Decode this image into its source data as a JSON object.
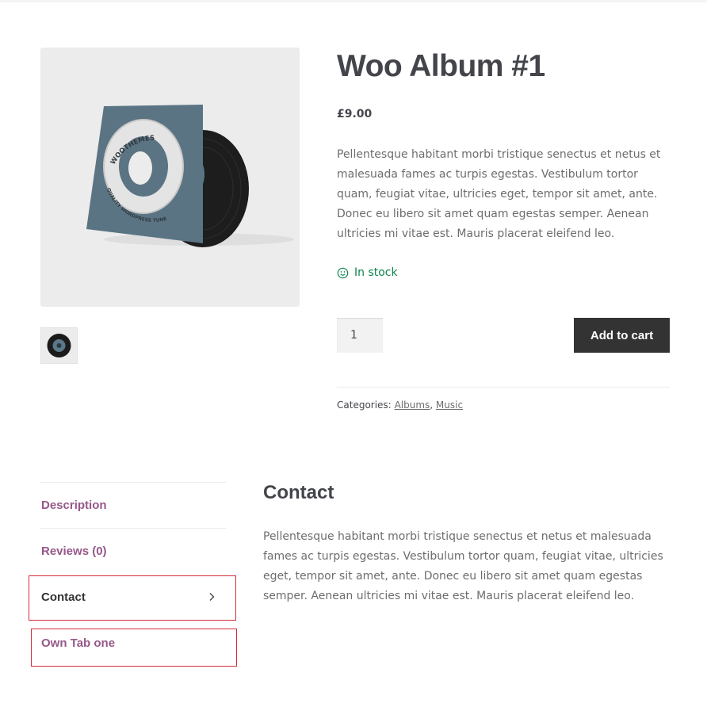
{
  "product": {
    "title": "Woo Album #1",
    "price": "£9.00",
    "description": "Pellentesque habitant morbi tristique senectus et netus et malesuada fames ac turpis egestas. Vestibulum tortor quam, feugiat vitae, ultricies eget, tempor sit amet, ante. Donec eu libero sit amet quam egestas semper. Aenean ultricies mi vitae est. Mauris placerat eleifend leo.",
    "stock": "In stock",
    "quantity": "1",
    "add_to_cart": "Add to cart",
    "categories_label": "Categories:",
    "categories": [
      "Albums",
      "Music"
    ],
    "image": {
      "cover_top_text": "WOOTHEMES",
      "cover_bottom_text": "QUALITY WORDPRESS TUNES"
    }
  },
  "tabs": {
    "items": [
      {
        "label": "Description"
      },
      {
        "label": "Reviews (0)"
      },
      {
        "label": "Contact"
      },
      {
        "label": "Own Tab one"
      }
    ],
    "active": "Contact"
  },
  "panel": {
    "title": "Contact",
    "text": "Pellentesque habitant morbi tristique senectus et netus et malesuada fames ac turpis egestas. Vestibulum tortor quam, feugiat vitae, ultricies eget, tempor sit amet, ante. Donec eu libero sit amet quam egestas semper. Aenean ultricies mi vitae est. Mauris placerat eleifend leo."
  },
  "colors": {
    "tab_link": "#96588a",
    "stock": "#0f834d",
    "button": "#333333",
    "highlight": "#d42c3a"
  },
  "icons": {
    "stock": "smiley-icon",
    "active_tab": "chevron-right-icon"
  }
}
